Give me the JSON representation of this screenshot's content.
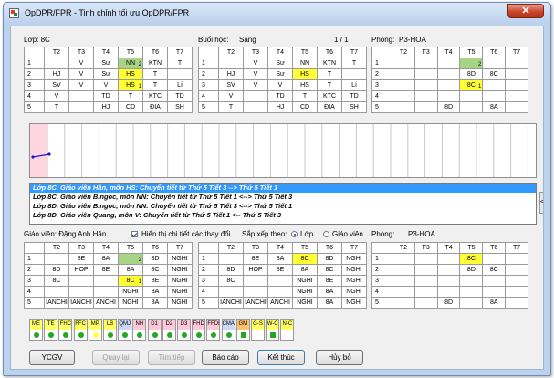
{
  "window": {
    "title": "OpDPR/FPR - Tinh chỉnh tối ưu OpDPR/FPR",
    "close": "✕"
  },
  "headers": [
    "T2",
    "T3",
    "T4",
    "T5",
    "T6",
    "T7"
  ],
  "top_class": {
    "label": "Lớp: 8C",
    "rows": [
      {
        "n": "1",
        "c": [
          "",
          "V",
          "Sư",
          "NN",
          "KTN",
          "T"
        ],
        "sub": {
          "3": "2"
        }
      },
      {
        "n": "2",
        "c": [
          "HJ",
          "V",
          "Sư",
          "HS",
          "T",
          ""
        ]
      },
      {
        "n": "3",
        "c": [
          "SV",
          "V",
          "V",
          "HS",
          "T",
          "Lí"
        ],
        "sub": {
          "3": "1"
        }
      },
      {
        "n": "4",
        "c": [
          "V",
          "",
          "TD",
          "T",
          "KTC",
          "TD"
        ]
      },
      {
        "n": "5",
        "c": [
          "T",
          "",
          "HJ",
          "CD",
          "ĐIA",
          "SH"
        ]
      }
    ]
  },
  "top_session": {
    "label": "Buổi học:",
    "value": "Sáng",
    "page": "1 / 1",
    "rows": [
      {
        "n": "1",
        "c": [
          "",
          "V",
          "Sư",
          "NN",
          "KTN",
          "T"
        ]
      },
      {
        "n": "2",
        "c": [
          "HJ",
          "V",
          "Sư",
          "HS",
          "T",
          ""
        ]
      },
      {
        "n": "3",
        "c": [
          "SV",
          "V",
          "V",
          "HS",
          "T",
          "Lí"
        ]
      },
      {
        "n": "4",
        "c": [
          "V",
          "",
          "TD",
          "T",
          "KTC",
          "TD"
        ]
      },
      {
        "n": "5",
        "c": [
          "T",
          "",
          "HJ",
          "CD",
          "ĐIA",
          "SH"
        ]
      }
    ]
  },
  "top_room": {
    "label": "Phòng:",
    "value": "P3-HOA",
    "rows": [
      {
        "n": "1",
        "c": [
          "",
          "",
          "",
          "",
          "",
          ""
        ],
        "sub": {
          "3": "2"
        }
      },
      {
        "n": "2",
        "c": [
          "",
          "",
          "",
          "8D",
          "8C",
          ""
        ]
      },
      {
        "n": "3",
        "c": [
          "",
          "",
          "",
          "8C",
          "",
          ""
        ],
        "sub": {
          "3": "1"
        }
      },
      {
        "n": "4",
        "c": [
          "",
          "",
          "",
          "",
          "",
          ""
        ]
      },
      {
        "n": "5",
        "c": [
          "",
          "",
          "8D",
          "",
          "8A",
          ""
        ]
      }
    ]
  },
  "log": [
    "Lớp 8C, Giáo viên Hân, môn HS: Chuyển tiết từ Thứ 5 Tiết 3 --> Thứ 5 Tiết 1",
    "Lớp 8C, Giáo viên B.ngọc, môn NN: Chuyển tiết từ Thứ 5 Tiết 1 <--> Thứ 5 Tiết 3",
    "Lớp 8D, Giáo viên B.ngọc, môn NN: Chuyển tiết từ Thứ 5 Tiết 3 <--> Thứ 5 Tiết 1",
    "Lớp 8D, Giáo viên Quang, môn V: Chuyển tiết từ Thứ 5 Tiết 1 <-- Thứ 5 Tiết 3"
  ],
  "options": {
    "teacher_label": "Giáo viên: Đặng Anh Hân",
    "show_detail": "Hiển thị chi tiết các thay đổi",
    "sort_label": "Sắp xếp theo:",
    "sort_class": "Lớp",
    "sort_teacher": "Giáo viên"
  },
  "bottom_teacher": {
    "rows": [
      {
        "n": "1",
        "c": [
          "",
          "8E",
          "8A",
          "",
          "8D",
          "NGHI"
        ],
        "sub": {
          "3": "2"
        }
      },
      {
        "n": "2",
        "c": [
          "8D",
          "HOP",
          "8E",
          "8A",
          "8C",
          "NGHI"
        ]
      },
      {
        "n": "3",
        "c": [
          "8C",
          "",
          "",
          "8C",
          "8E",
          "NGHI"
        ],
        "sub": {
          "3": "1"
        }
      },
      {
        "n": "4",
        "c": [
          "",
          "",
          "",
          "NGHI",
          "8A",
          "NGHI"
        ]
      },
      {
        "n": "5",
        "c": [
          "IANCHI",
          "IANCHI",
          "ANCHI",
          "NGHI",
          "8A",
          "NGHI"
        ]
      }
    ]
  },
  "bottom_teacher2": {
    "rows": [
      {
        "n": "1",
        "c": [
          "",
          "8E",
          "8A",
          "8C",
          "8D",
          "NGHI"
        ]
      },
      {
        "n": "2",
        "c": [
          "8D",
          "HOP",
          "8E",
          "8A",
          "8C",
          "NGHI"
        ]
      },
      {
        "n": "3",
        "c": [
          "8C",
          "",
          "",
          "NGHI",
          "8E",
          "NGHI"
        ]
      },
      {
        "n": "4",
        "c": [
          "",
          "",
          "",
          "NGHI",
          "8A",
          "NGHI"
        ]
      },
      {
        "n": "5",
        "c": [
          "IANCHI",
          "IANCHI",
          "ANCHI",
          "NGHI",
          "8A",
          "NGHI"
        ]
      }
    ]
  },
  "bottom_room": {
    "label": "Phòng:",
    "value": "P3-HOA",
    "rows": [
      {
        "n": "1",
        "c": [
          "",
          "",
          "",
          "8C",
          "",
          ""
        ]
      },
      {
        "n": "2",
        "c": [
          "",
          "",
          "",
          "8D",
          "8C",
          ""
        ]
      },
      {
        "n": "3",
        "c": [
          "",
          "",
          "",
          "",
          "",
          ""
        ]
      },
      {
        "n": "4",
        "c": [
          "",
          "",
          "",
          "",
          "",
          ""
        ]
      },
      {
        "n": "5",
        "c": [
          "",
          "",
          "8D",
          "",
          "8A",
          ""
        ]
      }
    ]
  },
  "legend": [
    {
      "code": "ME",
      "color": "#ffff66",
      "mark": "dot",
      "mark_color": "#22a822"
    },
    {
      "code": "TE",
      "color": "#ffff66",
      "mark": "dot",
      "mark_color": "#22a822"
    },
    {
      "code": "FHC",
      "color": "#ffff66",
      "mark": "dot",
      "mark_color": "#22a822"
    },
    {
      "code": "FFC",
      "color": "#ffff66",
      "mark": "dot",
      "mark_color": "#22a822"
    },
    {
      "code": "MP",
      "color": "#ffff66",
      "mark": "dot",
      "mark_color": "#ffff44"
    },
    {
      "code": "LB",
      "color": "#ffff66",
      "mark": "dot",
      "mark_color": "#22a822"
    },
    {
      "code": "QMJ",
      "color": "#c9d9f5",
      "mark": "dot",
      "mark_color": "#22a822"
    },
    {
      "code": "NH",
      "color": "#ffc8d8",
      "mark": "dot",
      "mark_color": "#22a822"
    },
    {
      "code": "D1",
      "color": "#ffc8d8",
      "mark": "dot",
      "mark_color": "#22a822"
    },
    {
      "code": "D2",
      "color": "#ffc8d8",
      "mark": "dot",
      "mark_color": "#22a822"
    },
    {
      "code": "D3",
      "color": "#ffc8d8",
      "mark": "dot",
      "mark_color": "#22a822"
    },
    {
      "code": "FHD",
      "color": "#ffc8d8",
      "mark": "dot",
      "mark_color": "#22a822"
    },
    {
      "code": "FFDI",
      "color": "#ffc8d8",
      "mark": "dot",
      "mark_color": "#22a822"
    },
    {
      "code": "CMA",
      "color": "#c9d9f5",
      "mark": "dot",
      "mark_color": "#22a822"
    },
    {
      "code": "GM",
      "color": "#ffc36b",
      "mark": "sq",
      "mark_color": "#22a822"
    },
    {
      "code": "G-S",
      "color": "#ffff66",
      "mark": "none",
      "mark_color": ""
    },
    {
      "code": "W-C",
      "color": "#ffff66",
      "mark": "sq",
      "mark_color": "#22a822"
    },
    {
      "code": "N-C",
      "color": "#ffff66",
      "mark": "none",
      "mark_color": ""
    }
  ],
  "buttons": {
    "ycgv": "YCGV",
    "back": "Quay lại",
    "find_next": "Tìm tiếp",
    "report": "Báo cáo",
    "finish": "Kết thúc",
    "cancel": "Hủy bỏ"
  },
  "splitter": "<"
}
